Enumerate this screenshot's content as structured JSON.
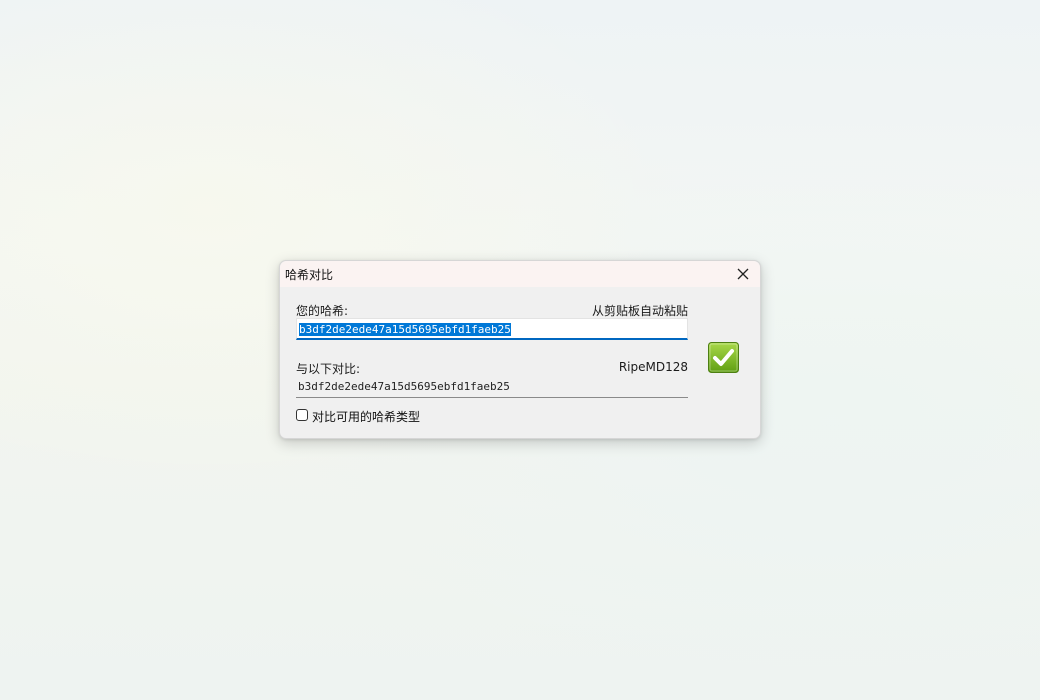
{
  "dialog": {
    "title": "哈希对比",
    "close_icon": "close-icon",
    "your_hash_label": "您的哈希:",
    "paste_link_label": "从剪贴板自动粘贴",
    "your_hash_value": "b3df2de2ede47a15d5695ebfd1faeb25",
    "compare_label": "与以下对比:",
    "hash_type": "RipeMD128",
    "compare_value": "b3df2de2ede47a15d5695ebfd1faeb25",
    "match_icon": "green-check-icon",
    "checkbox_label": "对比可用的哈希类型",
    "checkbox_checked": false
  },
  "colors": {
    "selection": "#0078d7",
    "focus_underline": "#0067c0",
    "match_green": "#7fbf1f"
  }
}
